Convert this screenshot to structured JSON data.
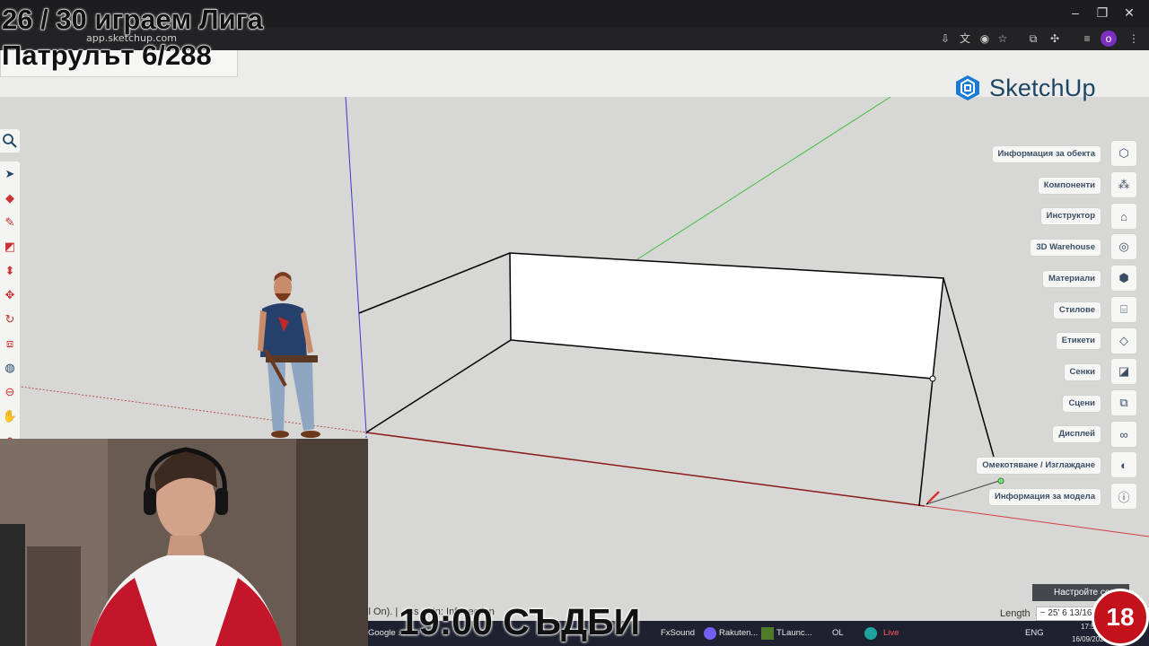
{
  "overlay": {
    "title_line1": "26 / 30 играем Лига",
    "title_line2": "Патрулът 6/288",
    "bottom_text": "19:00 СЪДБИ",
    "badge": "18"
  },
  "browser": {
    "url": "app.sketchup.com"
  },
  "app": {
    "logo_text": "SketchUp",
    "brand_color": "#1d4564",
    "axis_colors": {
      "red": "#8b1a1a",
      "green": "#3fbf3f",
      "blue": "#3a3ad0"
    }
  },
  "right_panel": {
    "items": [
      {
        "label": "Информация за обекта",
        "icon": "cube-info-icon"
      },
      {
        "label": "Компоненти",
        "icon": "components-icon"
      },
      {
        "label": "Инструктор",
        "icon": "graduation-cap-icon"
      },
      {
        "label": "3D Warehouse",
        "icon": "warehouse-icon"
      },
      {
        "label": "Материали",
        "icon": "materials-icon"
      },
      {
        "label": "Стилове",
        "icon": "styles-icon"
      },
      {
        "label": "Етикети",
        "icon": "tag-icon"
      },
      {
        "label": "Сенки",
        "icon": "shadows-icon"
      },
      {
        "label": "Сцени",
        "icon": "scenes-icon"
      },
      {
        "label": "Дисплей",
        "icon": "glasses-icon"
      },
      {
        "label": "Омекотяване / Изглаждане",
        "icon": "soften-icon"
      },
      {
        "label": "Информация за модела",
        "icon": "info-icon"
      }
    ]
  },
  "status_bar": {
    "hint": "ll On). | ...ss ... In: Inf... ection",
    "length_label": "Length",
    "length_value": "~ 25' 6 13/16\"",
    "settings_toast": "Настройте сега"
  },
  "taskbar": {
    "items": [
      "Google ...",
      "FxSound",
      "Rakuten...",
      "TLaunc...",
      "OL",
      "Live",
      "ENG"
    ],
    "time": "17:52",
    "date": "16/09/202..."
  }
}
